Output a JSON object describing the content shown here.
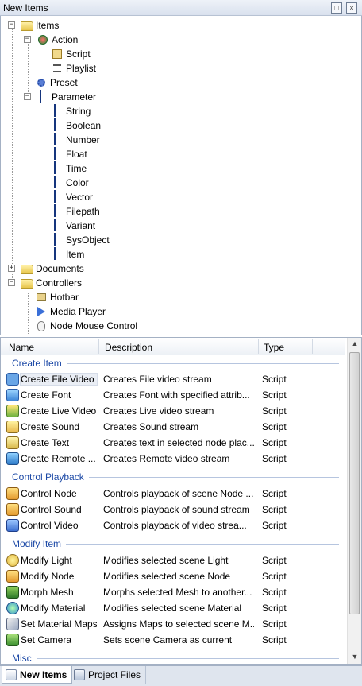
{
  "window": {
    "title": "New Items"
  },
  "tree": {
    "items": [
      {
        "label": "Items",
        "icon": "folder-icon"
      },
      {
        "label": "Action",
        "icon": "action-icon"
      },
      {
        "label": "Script",
        "icon": "script-icon"
      },
      {
        "label": "Playlist",
        "icon": "playlist-icon"
      },
      {
        "label": "Preset",
        "icon": "preset-icon"
      },
      {
        "label": "Parameter",
        "icon": "parameter-icon"
      },
      {
        "label": "String",
        "icon": "parameter-icon"
      },
      {
        "label": "Boolean",
        "icon": "parameter-icon"
      },
      {
        "label": "Number",
        "icon": "parameter-icon"
      },
      {
        "label": "Float",
        "icon": "parameter-icon"
      },
      {
        "label": "Time",
        "icon": "parameter-icon"
      },
      {
        "label": "Color",
        "icon": "parameter-icon"
      },
      {
        "label": "Vector",
        "icon": "parameter-icon"
      },
      {
        "label": "Filepath",
        "icon": "parameter-icon"
      },
      {
        "label": "Variant",
        "icon": "parameter-icon"
      },
      {
        "label": "SysObject",
        "icon": "parameter-icon"
      },
      {
        "label": "Item",
        "icon": "parameter-icon"
      },
      {
        "label": "Documents",
        "icon": "folder-icon"
      },
      {
        "label": "Controllers",
        "icon": "folder-icon"
      },
      {
        "label": "Hotbar",
        "icon": "hotbar-icon"
      },
      {
        "label": "Media Player",
        "icon": "play-icon"
      },
      {
        "label": "Node Mouse Control",
        "icon": "mouse-icon"
      }
    ]
  },
  "list": {
    "headers": {
      "name": "Name",
      "description": "Description",
      "type": "Type"
    },
    "groups": [
      {
        "label": "Create Item",
        "rows": [
          {
            "name": "Create File Video",
            "description": "Creates File video stream",
            "type": "Script",
            "icon": "file-video-icon"
          },
          {
            "name": "Create Font",
            "description": "Creates Font with specified attrib...",
            "type": "Script",
            "icon": "font-icon"
          },
          {
            "name": "Create Live Video",
            "description": "Creates Live video stream",
            "type": "Script",
            "icon": "live-video-icon"
          },
          {
            "name": "Create Sound",
            "description": "Creates Sound stream",
            "type": "Script",
            "icon": "sound-icon"
          },
          {
            "name": "Create Text",
            "description": "Creates text in selected node plac...",
            "type": "Script",
            "icon": "text-icon"
          },
          {
            "name": "Create Remote ...",
            "description": "Creates Remote video stream",
            "type": "Script",
            "icon": "remote-video-icon"
          }
        ]
      },
      {
        "label": "Control Playback",
        "rows": [
          {
            "name": "Control Node",
            "description": "Controls playback of scene Node ...",
            "type": "Script",
            "icon": "control-node-icon"
          },
          {
            "name": "Control Sound",
            "description": "Controls playback of sound stream",
            "type": "Script",
            "icon": "control-sound-icon"
          },
          {
            "name": "Control Video",
            "description": "Controls playback of video strea...",
            "type": "Script",
            "icon": "control-video-icon"
          }
        ]
      },
      {
        "label": "Modify Item",
        "rows": [
          {
            "name": "Modify Light",
            "description": "Modifies selected scene Light",
            "type": "Script",
            "icon": "light-icon"
          },
          {
            "name": "Modify Node",
            "description": "Modifies selected scene Node",
            "type": "Script",
            "icon": "node-icon"
          },
          {
            "name": "Morph Mesh",
            "description": "Morphs selected Mesh to another...",
            "type": "Script",
            "icon": "mesh-icon"
          },
          {
            "name": "Modify Material",
            "description": "Modifies selected scene Material",
            "type": "Script",
            "icon": "material-icon"
          },
          {
            "name": "Set Material Maps",
            "description": "Assigns Maps to selected scene M...",
            "type": "Script",
            "icon": "material-maps-icon"
          },
          {
            "name": "Set Camera",
            "description": "Sets scene Camera as current",
            "type": "Script",
            "icon": "camera-icon"
          }
        ]
      },
      {
        "label": "Misc",
        "rows": []
      }
    ]
  },
  "tabs": [
    {
      "label": "New Items",
      "active": true
    },
    {
      "label": "Project Files",
      "active": false
    }
  ]
}
